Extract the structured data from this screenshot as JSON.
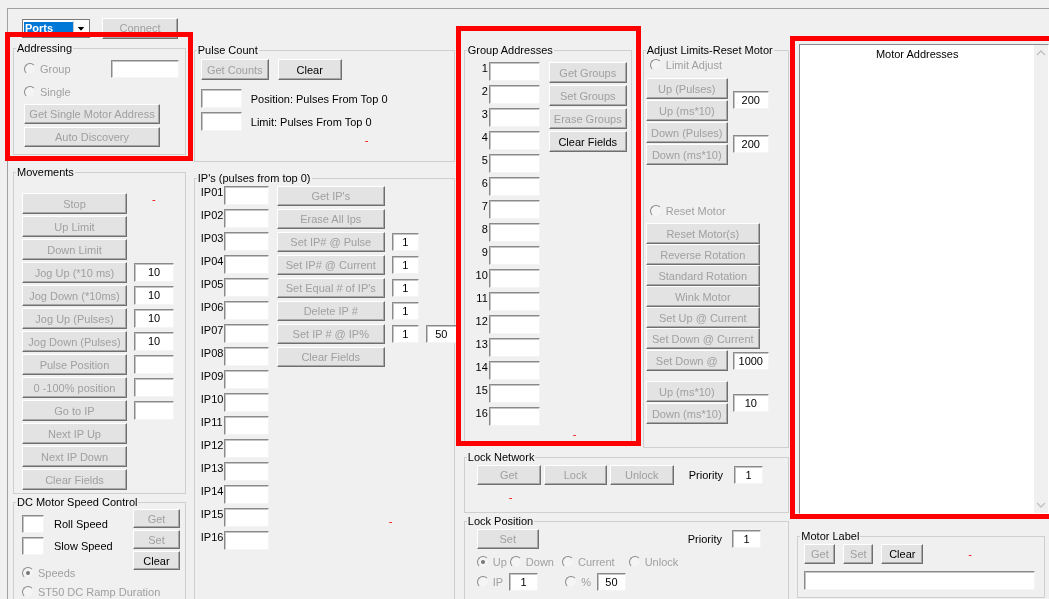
{
  "toolbar": {
    "port_dropdown": {
      "value": "Ports",
      "highlighted": true
    },
    "connect_button": {
      "label": "Connect",
      "disabled": true
    }
  },
  "addressing": {
    "title": "Addressing",
    "highlighted": true,
    "options": [
      {
        "label": "Group",
        "selected": false,
        "disabled": true
      },
      {
        "label": "Single",
        "selected": false,
        "disabled": true
      }
    ],
    "buttons": [
      {
        "label": "Get Single Motor Address",
        "disabled": true
      },
      {
        "label": "Auto Discovery",
        "disabled": true
      }
    ]
  },
  "movements": {
    "title": "Movements",
    "status": "-",
    "rows": [
      {
        "kind": "button",
        "label": "Stop",
        "disabled": true
      },
      {
        "kind": "button",
        "label": "Up Limit",
        "disabled": true
      },
      {
        "kind": "button",
        "label": "Down Limit",
        "disabled": true
      },
      {
        "kind": "with_field",
        "label": "Jog Up (*10 ms)",
        "disabled": true,
        "value": "10"
      },
      {
        "kind": "with_field",
        "label": "Jog Down (*10ms)",
        "disabled": true,
        "value": "10"
      },
      {
        "kind": "with_field",
        "label": "Jog Up (Pulses)",
        "disabled": true,
        "value": "10"
      },
      {
        "kind": "with_field",
        "label": "Jog Down (Pulses)",
        "disabled": true,
        "value": "10"
      },
      {
        "kind": "with_field",
        "label": "Pulse Position",
        "disabled": true
      },
      {
        "kind": "with_field",
        "label": "0 -100% position",
        "disabled": true
      },
      {
        "kind": "with_field",
        "label": "Go to IP",
        "disabled": true
      },
      {
        "kind": "button",
        "label": "Next IP Up",
        "disabled": true
      },
      {
        "kind": "button",
        "label": "Next IP Down",
        "disabled": true
      },
      {
        "kind": "button",
        "label": "Clear Fields",
        "disabled": true
      }
    ]
  },
  "dc_motor_speed": {
    "title": "DC Motor Speed Control",
    "speeds": [
      {
        "label": "Roll Speed"
      },
      {
        "label": "Slow Speed"
      }
    ],
    "buttons": [
      {
        "label": "Get",
        "disabled": true
      },
      {
        "label": "Set",
        "disabled": true
      },
      {
        "label": "Clear",
        "disabled": false
      }
    ],
    "options": [
      {
        "label": "Speeds",
        "selected": true,
        "disabled": true
      },
      {
        "label": "ST50 DC Ramp Duration",
        "selected": false,
        "disabled": true
      }
    ]
  },
  "pulse_count": {
    "title": "Pulse Count",
    "buttons": [
      {
        "label": "Get Counts",
        "disabled": true
      },
      {
        "label": "Clear",
        "disabled": false
      }
    ],
    "readouts": [
      {
        "label": "Position: Pulses From Top 0"
      },
      {
        "label": "Limit: Pulses From Top 0"
      }
    ],
    "status": "-"
  },
  "ips": {
    "title": "IP's (pulses from top 0)",
    "status": "-",
    "slots": [
      {
        "label": "IP01"
      },
      {
        "label": "IP02"
      },
      {
        "label": "IP03"
      },
      {
        "label": "IP04"
      },
      {
        "label": "IP05"
      },
      {
        "label": "IP06"
      },
      {
        "label": "IP07"
      },
      {
        "label": "IP08"
      },
      {
        "label": "IP09"
      },
      {
        "label": "IP10"
      },
      {
        "label": "IP11"
      },
      {
        "label": "IP12"
      },
      {
        "label": "IP13"
      },
      {
        "label": "IP14"
      },
      {
        "label": "IP15"
      },
      {
        "label": "IP16"
      }
    ],
    "buttons": [
      {
        "label": "Get IP's",
        "disabled": true
      },
      {
        "label": "Erase All Ips",
        "disabled": true
      },
      {
        "label": "Set IP# @ Pulse",
        "disabled": true,
        "values": [
          "1"
        ]
      },
      {
        "label": "Set IP# @ Current",
        "disabled": true,
        "values": [
          "1"
        ]
      },
      {
        "label": "Set Equal # of IP's",
        "disabled": true,
        "values": [
          "1"
        ]
      },
      {
        "label": "Delete IP #",
        "disabled": true,
        "values": [
          "1"
        ]
      },
      {
        "label": "Set IP # @ IP%",
        "disabled": true,
        "values": [
          "1",
          "50"
        ]
      },
      {
        "label": "Clear Fields",
        "disabled": true
      }
    ]
  },
  "group_addresses": {
    "title": "Group Addresses",
    "highlighted": true,
    "status": "-",
    "slots": [
      {
        "label": "1"
      },
      {
        "label": "2"
      },
      {
        "label": "3"
      },
      {
        "label": "4"
      },
      {
        "label": "5"
      },
      {
        "label": "6"
      },
      {
        "label": "7"
      },
      {
        "label": "8"
      },
      {
        "label": "9"
      },
      {
        "label": "10"
      },
      {
        "label": "11"
      },
      {
        "label": "12"
      },
      {
        "label": "13"
      },
      {
        "label": "14"
      },
      {
        "label": "15"
      },
      {
        "label": "16"
      }
    ],
    "buttons": [
      {
        "label": "Get Groups",
        "disabled": true
      },
      {
        "label": "Set Groups",
        "disabled": true
      },
      {
        "label": "Erase Groups",
        "disabled": true
      },
      {
        "label": "Clear Fields",
        "disabled": false
      }
    ]
  },
  "adjust_limits": {
    "title": "Adjust Limits-Reset Motor",
    "sections": [
      {
        "kind": "radio",
        "label": "Limit Adjust",
        "selected": false,
        "disabled": true
      },
      {
        "kind": "pair",
        "buttons": [
          {
            "label": "Up (Pulses)",
            "disabled": true
          },
          {
            "label": "Up (ms*10)",
            "disabled": true
          }
        ],
        "value": "200"
      },
      {
        "kind": "pair",
        "buttons": [
          {
            "label": "Down (Pulses)",
            "disabled": true
          },
          {
            "label": "Down (ms*10)",
            "disabled": true
          }
        ],
        "value": "200"
      },
      {
        "kind": "radio",
        "label": "Reset Motor",
        "selected": false,
        "disabled": true
      },
      {
        "kind": "stack",
        "buttons": [
          {
            "label": "Reset Motor(s)",
            "disabled": true
          },
          {
            "label": "Reverse  Rotation",
            "disabled": true
          },
          {
            "label": "Standard Rotation",
            "disabled": true
          },
          {
            "label": "Wink Motor",
            "disabled": true
          },
          {
            "label": "Set Up @ Current",
            "disabled": true
          },
          {
            "label": "Set Down @ Current",
            "disabled": true
          }
        ]
      },
      {
        "kind": "pair",
        "buttons": [
          {
            "label": "Set Down @",
            "disabled": true
          }
        ],
        "value": "1000"
      },
      {
        "kind": "pair",
        "buttons": [
          {
            "label": "Up (ms*10)",
            "disabled": true
          },
          {
            "label": "Down (ms*10)",
            "disabled": true
          }
        ],
        "value": "10"
      }
    ]
  },
  "lock_network": {
    "title": "Lock Network",
    "buttons": [
      {
        "label": "Get",
        "disabled": true
      },
      {
        "label": "Lock",
        "disabled": true
      },
      {
        "label": "Unlock",
        "disabled": true
      }
    ],
    "priority_label": "Priority",
    "priority": "1",
    "status": "-"
  },
  "lock_position": {
    "title": "Lock Position",
    "button": {
      "label": "Set",
      "disabled": true
    },
    "priority_label": "Priority",
    "priority": "1",
    "directions": [
      {
        "label": "Up",
        "selected": true,
        "disabled": true
      },
      {
        "label": "Down",
        "selected": false,
        "disabled": true
      },
      {
        "label": "Current",
        "selected": false,
        "disabled": true
      },
      {
        "label": "Unlock",
        "selected": false,
        "disabled": true
      }
    ],
    "targets": [
      {
        "label": "IP",
        "selected": false,
        "disabled": true,
        "value": "1"
      },
      {
        "label": "%",
        "selected": false,
        "disabled": true,
        "value": "50"
      }
    ]
  },
  "motor_addresses": {
    "header": "Motor Addresses",
    "highlighted": true
  },
  "motor_label": {
    "title": "Motor Label",
    "buttons": [
      {
        "label": "Get",
        "disabled": true
      },
      {
        "label": "Set",
        "disabled": true
      },
      {
        "label": "Clear",
        "disabled": false
      }
    ],
    "status": "-"
  }
}
